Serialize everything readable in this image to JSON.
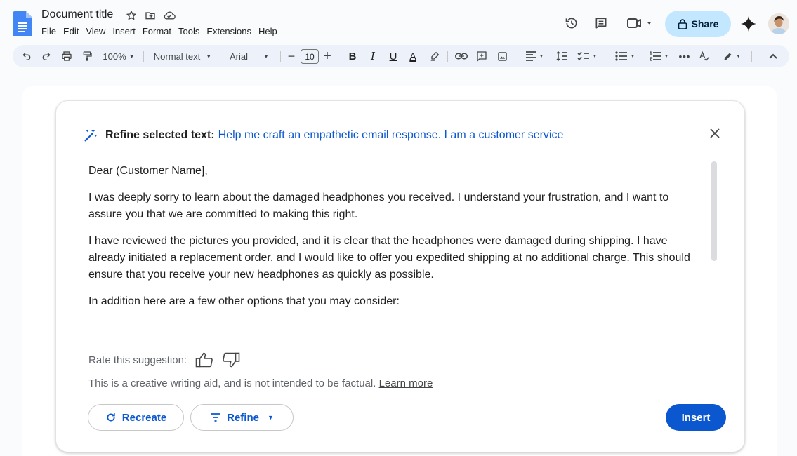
{
  "document": {
    "title": "Document title"
  },
  "menu": [
    "File",
    "Edit",
    "View",
    "Insert",
    "Format",
    "Tools",
    "Extensions",
    "Help"
  ],
  "header": {
    "share_label": "Share"
  },
  "toolbar": {
    "zoom": "100%",
    "style": "Normal text",
    "font": "Arial",
    "font_size": "10"
  },
  "refine": {
    "label": "Refine selected text:",
    "prompt": "Help me craft an empathetic email response. I am a customer service",
    "body": [
      "Dear (Customer Name],",
      "I was deeply sorry to learn about the damaged headphones you received. I understand your frustration, and I want to assure you that we are committed to making this right.",
      "I have reviewed the pictures you provided, and it is clear that the headphones were damaged during shipping. I have already initiated a replacement order, and I would like to offer you expedited shipping at no additional charge. This should ensure that you receive your new headphones as quickly as possible.",
      "In addition here are a few other options that you may consider:"
    ],
    "rate_label": "Rate this suggestion:",
    "disclaimer": "This is a creative writing aid, and is not intended to be factual.",
    "learn_more": "Learn more",
    "recreate_label": "Recreate",
    "refine_label": "Refine",
    "insert_label": "Insert"
  },
  "colors": {
    "accent": "#0b57d0",
    "share_bg": "#c2e7ff",
    "toolbar_bg": "#edf2fa"
  }
}
